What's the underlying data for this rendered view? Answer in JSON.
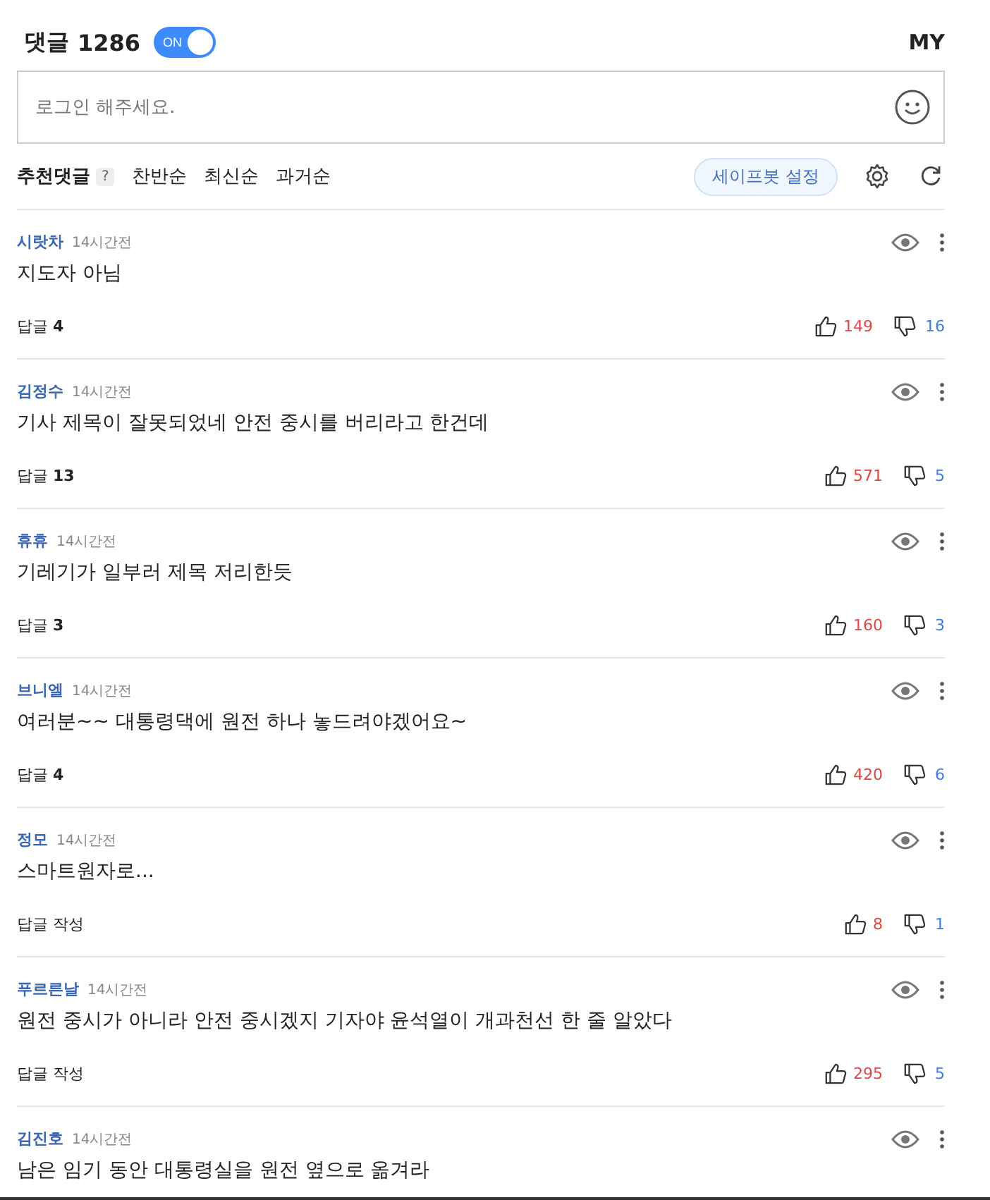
{
  "header": {
    "title": "댓글",
    "count": "1286",
    "toggle": {
      "label": "ON",
      "on": true
    },
    "my": "MY"
  },
  "input": {
    "placeholder": "로그인 해주세요."
  },
  "sort_tabs": [
    {
      "label": "추천댓글",
      "selected": true,
      "help": "?"
    },
    {
      "label": "찬반순",
      "selected": false
    },
    {
      "label": "최신순",
      "selected": false
    },
    {
      "label": "과거순",
      "selected": false
    }
  ],
  "safebot": "세이프봇 설정",
  "comments": [
    {
      "author": "시랏차",
      "time": "14시간전",
      "text": "지도자 아님",
      "replies": "답글 **4**",
      "likes": "149",
      "dislikes": "16"
    },
    {
      "author": "김정수",
      "time": "14시간전",
      "text": "기사 제목이 잘못되었네 안전 중시를 버리라고 한건데",
      "replies": "답글 **13**",
      "likes": "571",
      "dislikes": "5"
    },
    {
      "author": "휴휴",
      "time": "14시간전",
      "text": "기레기가 일부러 제목 저리한듯",
      "replies": "답글 **3**",
      "likes": "160",
      "dislikes": "3"
    },
    {
      "author": "브니엘",
      "time": "14시간전",
      "text": "여러분~~ 대통령댁에 원전 하나 놓드려야겠어요~",
      "replies": "답글 **4**",
      "likes": "420",
      "dislikes": "6"
    },
    {
      "author": "정모",
      "time": "14시간전",
      "text": "스마트원자로...",
      "replies": "답글 작성",
      "likes": "8",
      "dislikes": "1"
    },
    {
      "author": "푸르른날",
      "time": "14시간전",
      "text": "원전 중시가 아니라 안전 중시겠지 기자야 윤석열이 개과천선 한 줄 알았다",
      "replies": "답글 작성",
      "likes": "295",
      "dislikes": "5"
    },
    {
      "author": "김진호",
      "time": "14시간전",
      "text": "남은 임기 동안 대통령실을 원전 옆으로 옮겨라"
    }
  ]
}
